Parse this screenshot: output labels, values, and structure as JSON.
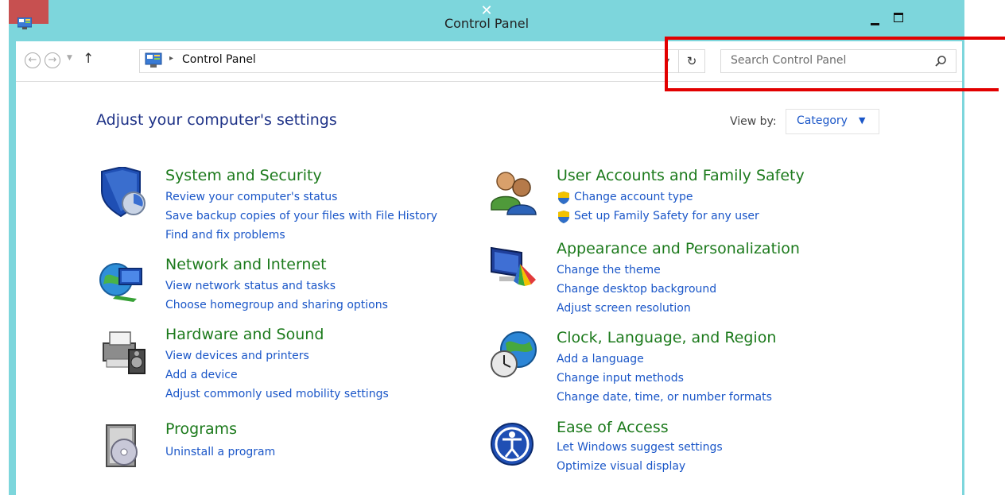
{
  "window": {
    "title": "Control Panel",
    "close_symbol": "✕",
    "title_color": "#7dd6dc",
    "close_color": "#c75050"
  },
  "navbar": {
    "back_symbol": "←",
    "forward_symbol": "→",
    "recent_symbol": "▼",
    "up_symbol": "↑",
    "address_separator": "▸",
    "address_text": "Control Panel",
    "refresh_symbol": "↻",
    "search_placeholder": "Search Control Panel"
  },
  "main": {
    "heading": "Adjust your computer's settings",
    "view_by_label": "View by:",
    "view_by_value": "Category",
    "view_by_arrow": "▼"
  },
  "categories": [
    {
      "title": "System and Security",
      "icon": "shield-icon",
      "links": [
        "Review your computer's status",
        "Save backup copies of your files with File History",
        "Find and fix problems"
      ]
    },
    {
      "title": "Network and Internet",
      "icon": "network-globe-icon",
      "links": [
        "View network status and tasks",
        "Choose homegroup and sharing options"
      ]
    },
    {
      "title": "Hardware and Sound",
      "icon": "printer-speaker-icon",
      "links": [
        "View devices and printers",
        "Add a device",
        "Adjust commonly used mobility settings"
      ]
    },
    {
      "title": "Programs",
      "icon": "programs-disc-icon",
      "links": [
        "Uninstall a program"
      ]
    },
    {
      "title": "User Accounts and Family Safety",
      "icon": "users-icon",
      "links": [
        "Change account type",
        "Set up Family Safety for any user"
      ]
    },
    {
      "title": "Appearance and Personalization",
      "icon": "monitor-palette-icon",
      "links": [
        "Change the theme",
        "Change desktop background",
        "Adjust screen resolution"
      ]
    },
    {
      "title": "Clock, Language, and Region",
      "icon": "globe-clock-icon",
      "links": [
        "Add a language",
        "Change input methods",
        "Change date, time, or number formats"
      ]
    },
    {
      "title": "Ease of Access",
      "icon": "ease-of-access-icon",
      "links": [
        "Let Windows suggest settings",
        "Optimize visual display"
      ]
    }
  ],
  "colors": {
    "heading": "#1e3287",
    "category_title": "#1c7a1c",
    "link": "#1a56c8",
    "highlight": "#e20000"
  }
}
